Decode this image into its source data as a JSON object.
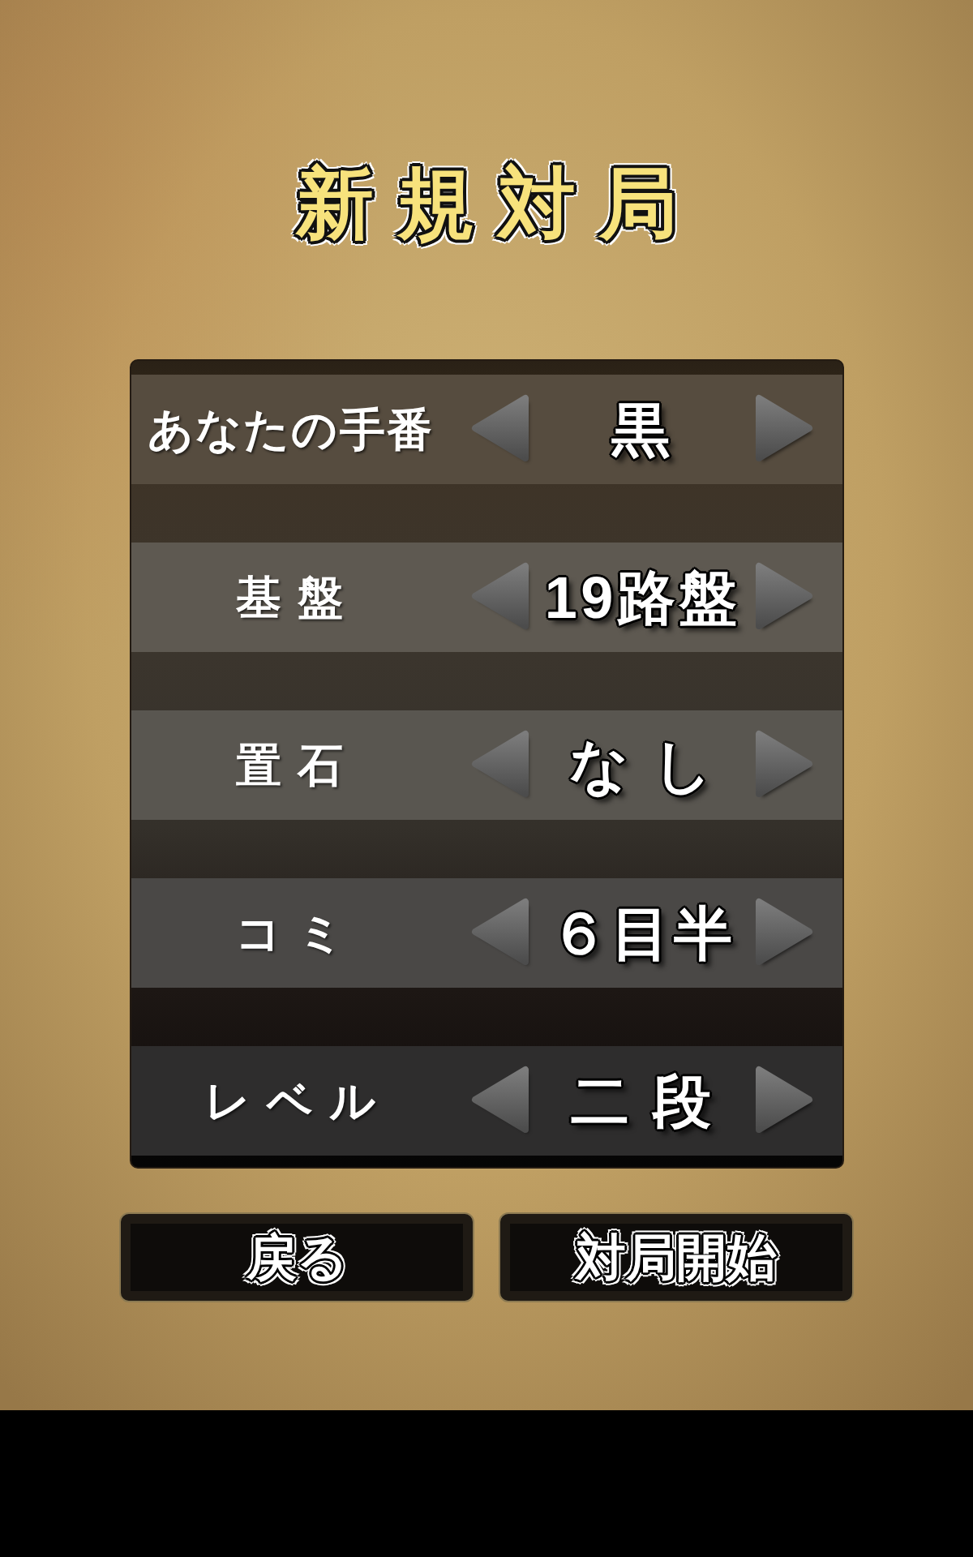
{
  "title": "新規対局",
  "settings": [
    {
      "label": "あなたの手番",
      "value": "黒"
    },
    {
      "label": "基 盤",
      "value": "19路盤"
    },
    {
      "label": "置 石",
      "value": "な し"
    },
    {
      "label": "コ ミ",
      "value": "６目半"
    },
    {
      "label": "レ ベ ル",
      "value": "二 段"
    }
  ],
  "buttons": [
    {
      "label": "戻る"
    },
    {
      "label": "対局開始"
    }
  ]
}
